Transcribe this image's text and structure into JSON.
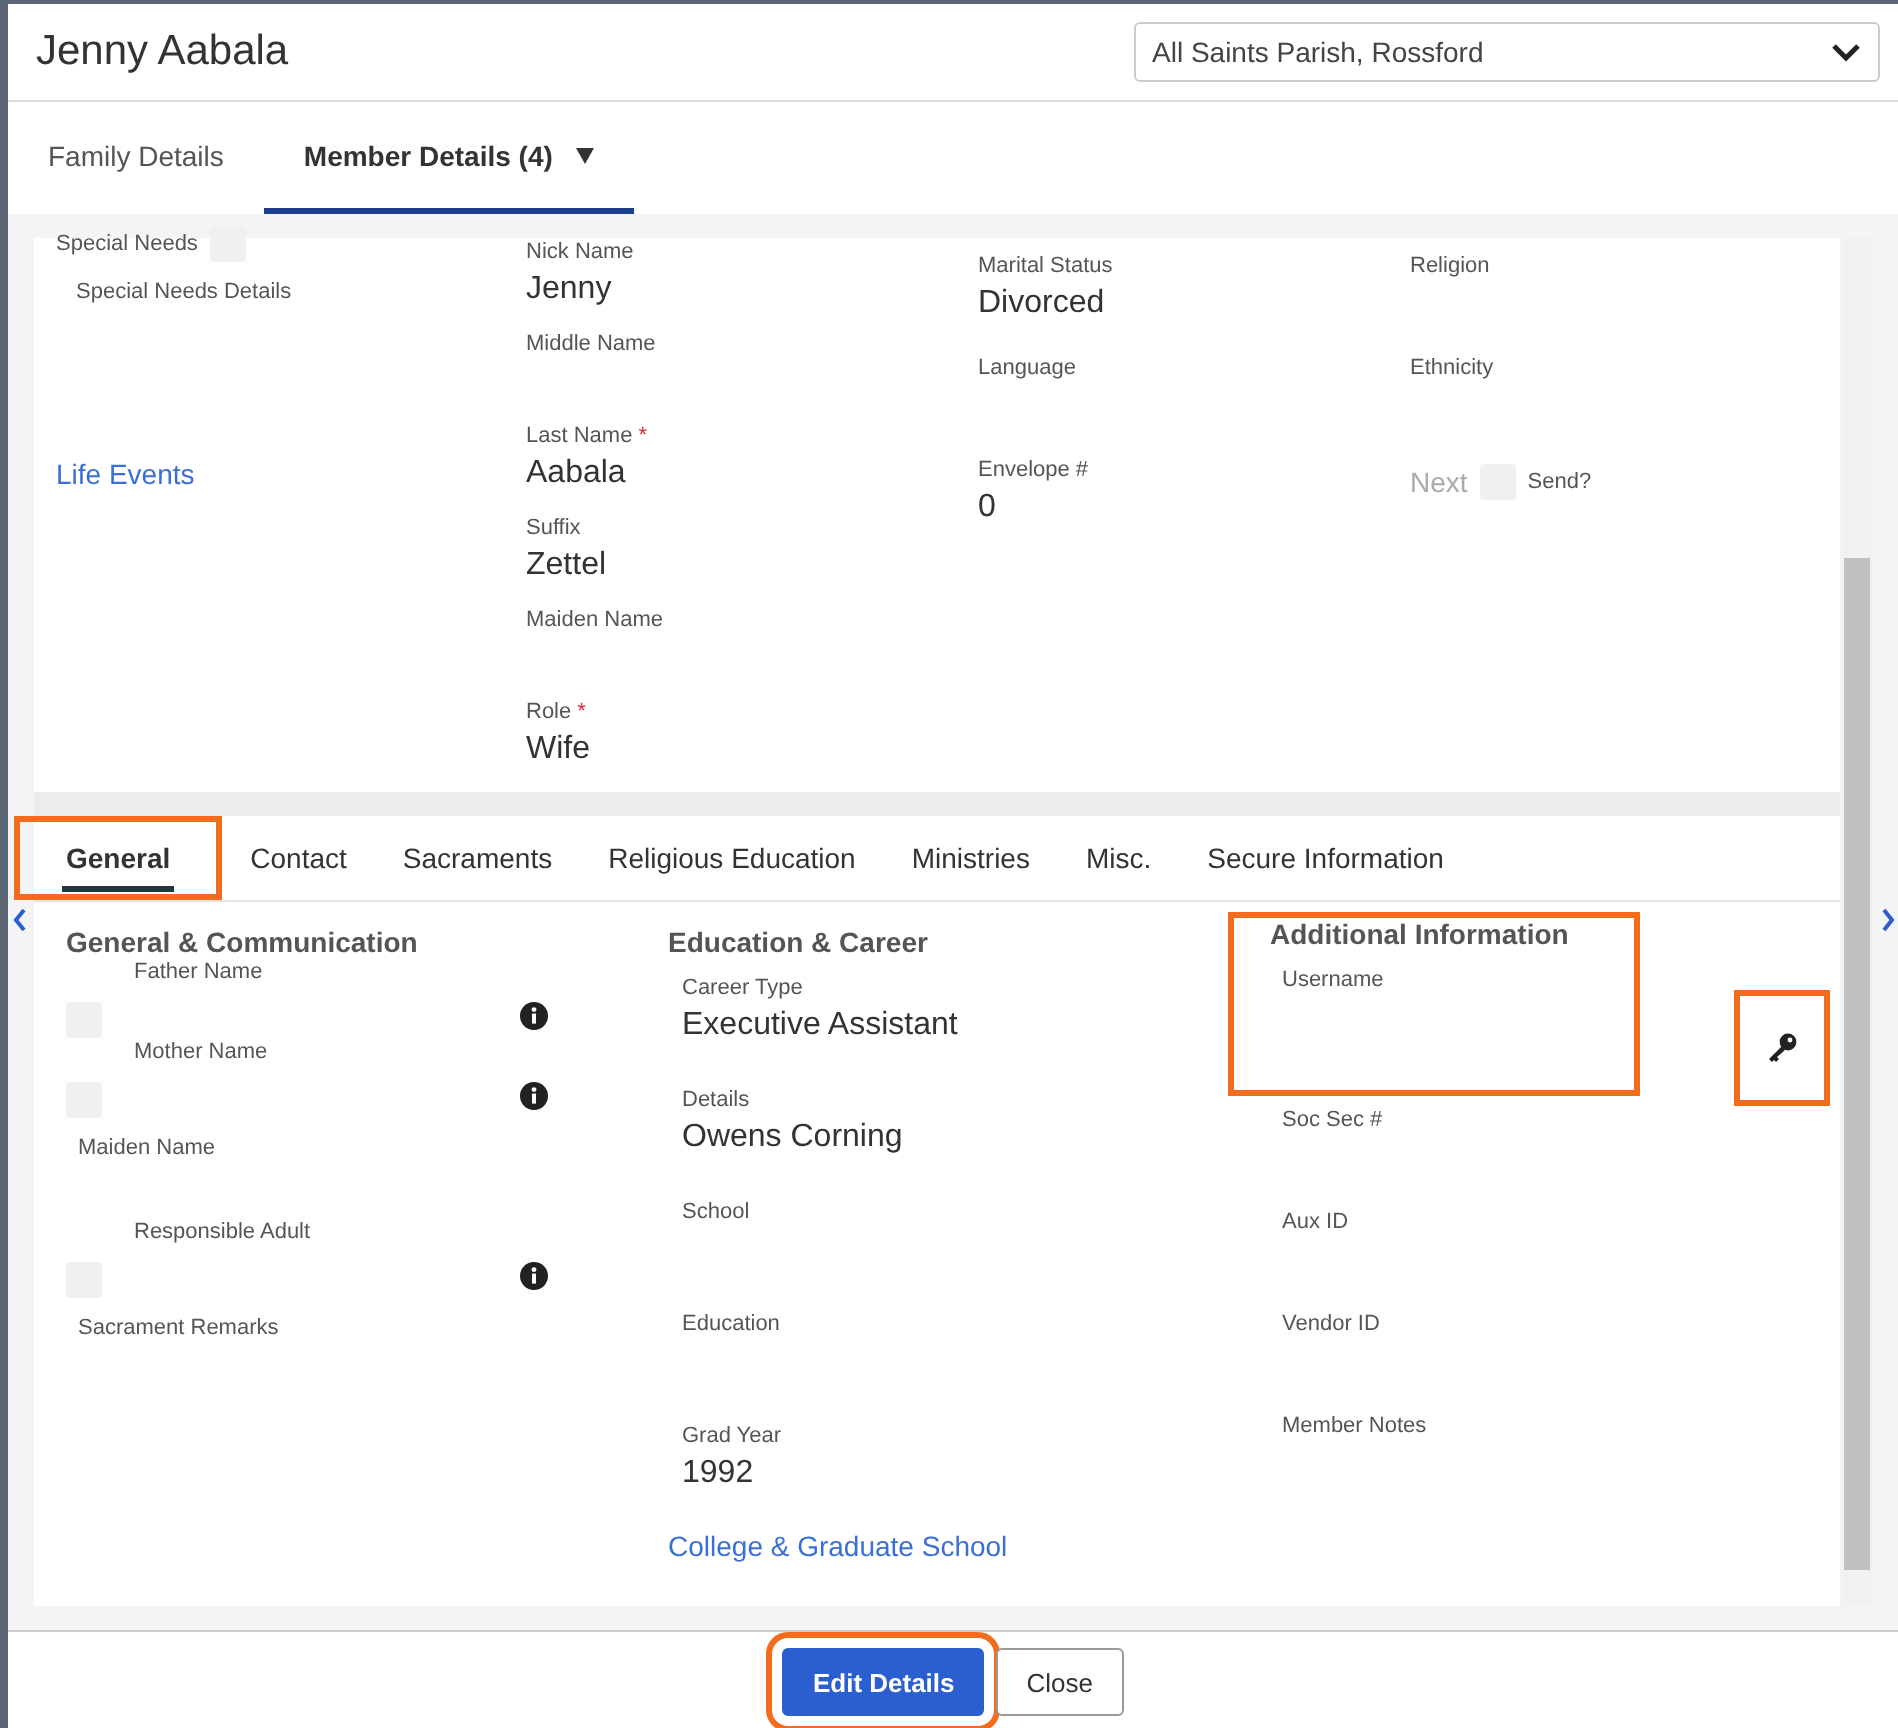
{
  "window": {
    "title": "Jenny Aabala",
    "parish": {
      "value": "All Saints Parish, Rossford"
    }
  },
  "tabs": [
    {
      "label": "Family Details",
      "selected": false,
      "dropdown": false
    },
    {
      "label": "Member Details (4)",
      "selected": true,
      "dropdown": true
    }
  ],
  "member_columns": [
    [
      {
        "kind": "check_right",
        "label": "Special Needs",
        "checked": false
      },
      {
        "kind": "field",
        "label": "Special Needs Details"
      },
      {
        "kind": "link",
        "label": "Life Events"
      }
    ],
    [
      {
        "kind": "field",
        "label": "Nick Name",
        "value": "Jenny"
      },
      {
        "kind": "field",
        "label": "Middle Name"
      },
      {
        "kind": "field",
        "label": "Last Name",
        "required_mark": "*",
        "value": "Aabala"
      },
      {
        "kind": "field",
        "label": "Suffix",
        "value": "Zettel"
      },
      {
        "kind": "field",
        "label": "Maiden Name"
      },
      {
        "kind": "field",
        "label": "Role",
        "required_mark": "*",
        "value": "Wife"
      }
    ],
    [
      {
        "kind": "field",
        "label": "Marital Status",
        "value": "Divorced"
      },
      {
        "kind": "field",
        "label": "Language"
      },
      {
        "kind": "field",
        "label": "Envelope #",
        "value": "0"
      }
    ],
    [
      {
        "kind": "field",
        "label": "Religion"
      },
      {
        "kind": "field",
        "label": "Ethnicity"
      },
      {
        "kind": "next_send",
        "label": "Next",
        "disabled": true,
        "checkbox_label": "Send?",
        "checked": false
      }
    ]
  ],
  "detail_tabs": [
    {
      "label": "General",
      "selected": true,
      "highlighted": true
    },
    {
      "label": "Contact",
      "selected": false
    },
    {
      "label": "Sacraments",
      "selected": false
    },
    {
      "label": "Religious Education",
      "selected": false
    },
    {
      "label": "Ministries",
      "selected": false
    },
    {
      "label": "Misc.",
      "selected": false
    },
    {
      "label": "Secure Information",
      "selected": false
    }
  ],
  "sections": [
    {
      "title": "General & Communication",
      "fields": [
        {
          "kind": "checkbox",
          "label": "Father Name",
          "checked": false,
          "info": true
        },
        {
          "kind": "checkbox",
          "label": "Mother Name",
          "checked": false,
          "info": true
        },
        {
          "kind": "field",
          "label": "Maiden Name"
        },
        {
          "kind": "checkbox",
          "label": "Responsible Adult",
          "checked": false,
          "info": true
        },
        {
          "kind": "field",
          "label": "Sacrament Remarks"
        }
      ]
    },
    {
      "title": "Education & Career",
      "fields": [
        {
          "kind": "field",
          "label": "Career Type",
          "value": "Executive Assistant"
        },
        {
          "kind": "field",
          "label": "Details",
          "value": "Owens Corning"
        },
        {
          "kind": "field",
          "label": "School"
        },
        {
          "kind": "field",
          "label": "Education"
        },
        {
          "kind": "field",
          "label": "Grad Year",
          "value": "1992"
        },
        {
          "kind": "link",
          "label": "College & Graduate School"
        }
      ]
    },
    {
      "title": "Additional Information",
      "highlighted": true,
      "fields": [
        {
          "kind": "field",
          "label": "Username"
        },
        {
          "kind": "field",
          "label": "Soc Sec #"
        },
        {
          "kind": "field",
          "label": "Aux ID"
        },
        {
          "kind": "field",
          "label": "Vendor ID"
        },
        {
          "kind": "field",
          "label": "Member Notes"
        }
      ]
    }
  ],
  "key_button": {
    "highlighted": true
  },
  "buttons": [
    {
      "label": "Edit Details",
      "kind": "primary",
      "highlighted": true
    },
    {
      "label": "Close",
      "kind": "secondary",
      "highlighted": false
    }
  ]
}
